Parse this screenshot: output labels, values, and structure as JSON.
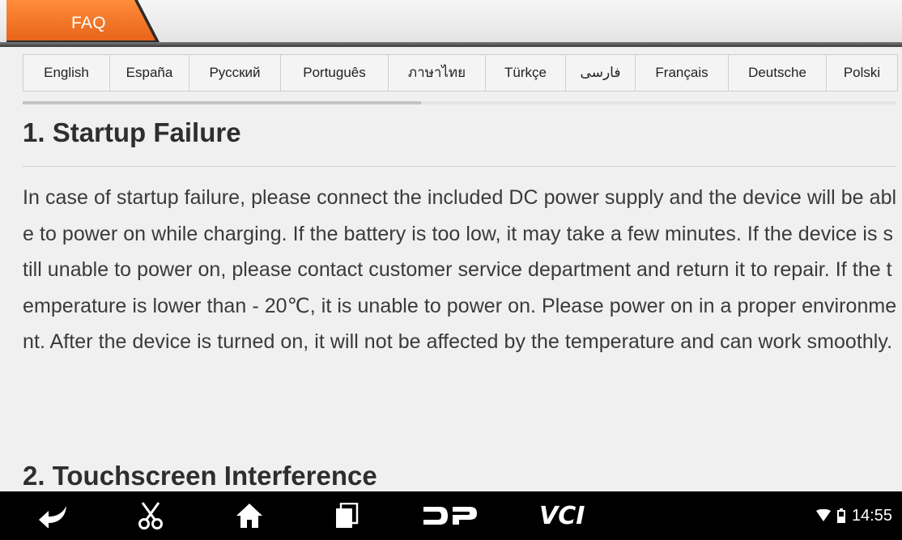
{
  "header": {
    "tab_label": "FAQ",
    "accent_color": "#f27a22"
  },
  "languages": {
    "items": [
      {
        "label": "English"
      },
      {
        "label": "España"
      },
      {
        "label": "Русский"
      },
      {
        "label": "Português"
      },
      {
        "label": "ภาษาไทย"
      },
      {
        "label": "Türkçe"
      },
      {
        "label": "فارسی"
      },
      {
        "label": "Français"
      },
      {
        "label": "Deutsche"
      },
      {
        "label": "Polski"
      }
    ],
    "scroll_fraction_visible": 0.45
  },
  "content": {
    "sections": [
      {
        "title": "1. Startup Failure",
        "body": "In case of startup failure, please connect the included DC power supply and the device will be able to power on while charging. If the battery is too low, it may take a few minutes. If the device is still unable to power on, please contact customer service department and return it to repair. If the temperature is lower than - 20℃, it is unable to power on. Please power on in a proper environment. After the device is turned on, it will not be affected by the temperature and can work smoothly."
      },
      {
        "title": "2. Touchscreen Interference"
      }
    ]
  },
  "navbar": {
    "buttons": [
      {
        "icon": "back-icon"
      },
      {
        "icon": "scissors-icon"
      },
      {
        "icon": "home-icon"
      },
      {
        "icon": "recent-apps-icon"
      },
      {
        "icon": "dp-logo-icon"
      },
      {
        "icon": "vci-icon"
      }
    ],
    "vci_label": "VCI",
    "time": "14:55"
  }
}
